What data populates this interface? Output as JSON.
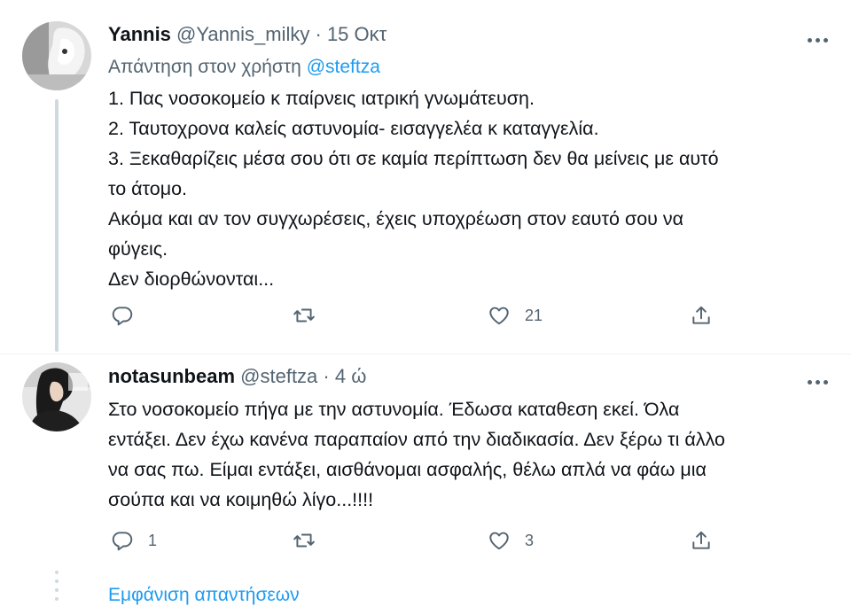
{
  "tweets": [
    {
      "name": "Yannis",
      "handle": "@Yannis_milky",
      "separator": "·",
      "time": "15 Οκτ",
      "reply_prefix": "Απάντηση στον χρήστη",
      "reply_handle": "@steftza",
      "lines": [
        "1. Πας νοσοκομείο κ παίρνεις ιατρική γνωμάτευση.",
        "2. Ταυτοχρονα καλείς αστυνομία- εισαγγελέα κ καταγγελία.",
        "3. Ξεκαθαρίζεις μέσα σου ότι σε καμία περίπτωση δεν θα μείνεις με αυτό",
        "το άτομο.",
        "Ακόμα και αν τον συγχωρέσεις, έχεις υποχρέωση στον εαυτό σου να",
        "φύγεις.",
        "Δεν διορθώνονται..."
      ],
      "replies": "",
      "retweets": "",
      "likes": "21"
    },
    {
      "name": "notasunbeam",
      "handle": "@steftza",
      "separator": "·",
      "time": "4 ώ",
      "lines": [
        "Στο νοσοκομείο πήγα με την αστυνομία. Έδωσα καταθεση εκεί. Όλα",
        "εντάξει. Δεν έχω κανένα παραπαίον από την διαδικασία. Δεν ξέρω τι άλλο",
        "να σας πω. Είμαι εντάξει, αισθάνομαι ασφαλής, θέλω απλά να φάω μια",
        "σούπα και να κοιμηθώ λίγο...!!!!"
      ],
      "replies": "1",
      "retweets": "",
      "likes": "3"
    }
  ],
  "show_replies": "Εμφάνιση απαντήσεων",
  "colors": {
    "accent": "#1d9bf0",
    "muted": "#536471",
    "text": "#0f1419",
    "line": "#cfd9de"
  },
  "icons": [
    "reply-icon",
    "retweet-icon",
    "like-icon",
    "share-icon",
    "more-icon"
  ]
}
